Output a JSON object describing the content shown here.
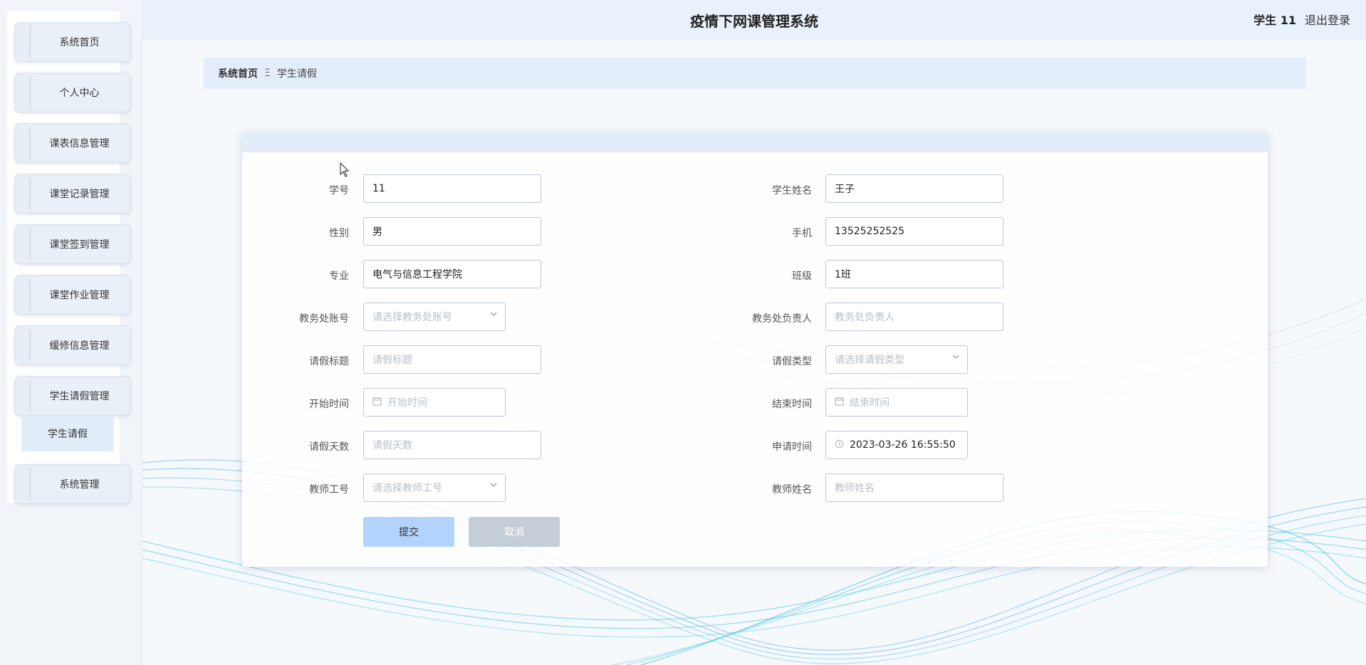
{
  "header": {
    "title": "疫情下网课管理系统",
    "user": "学生 11",
    "logout": "退出登录"
  },
  "sidebar": {
    "items": [
      {
        "label": "系统首页"
      },
      {
        "label": "个人中心"
      },
      {
        "label": "课表信息管理"
      },
      {
        "label": "课堂记录管理"
      },
      {
        "label": "课堂签到管理"
      },
      {
        "label": "课堂作业管理"
      },
      {
        "label": "缓修信息管理"
      },
      {
        "label": "学生请假管理"
      },
      {
        "label": "系统管理"
      }
    ],
    "submenu": {
      "label": "学生请假"
    }
  },
  "breadcrumb": {
    "home": "系统首页",
    "separator": "Ξ",
    "current": "学生请假"
  },
  "form": {
    "student_no": {
      "label": "学号",
      "value": "11"
    },
    "student_name": {
      "label": "学生姓名",
      "value": "王子"
    },
    "gender": {
      "label": "性别",
      "value": "男"
    },
    "phone": {
      "label": "手机",
      "value": "13525252525"
    },
    "major": {
      "label": "专业",
      "value": "电气与信息工程学院"
    },
    "class": {
      "label": "班级",
      "value": "1班"
    },
    "office_account": {
      "label": "教务处账号",
      "placeholder": "请选择教务处账号"
    },
    "office_manager": {
      "label": "教务处负责人",
      "placeholder": "教务处负责人"
    },
    "leave_title": {
      "label": "请假标题",
      "placeholder": "请假标题"
    },
    "leave_type": {
      "label": "请假类型",
      "placeholder": "请选择请假类型"
    },
    "start_time": {
      "label": "开始时间",
      "placeholder": "开始时间"
    },
    "end_time": {
      "label": "结束时间",
      "placeholder": "结束时间"
    },
    "leave_days": {
      "label": "请假天数",
      "placeholder": "请假天数"
    },
    "apply_time": {
      "label": "申请时间",
      "value": "2023-03-26 16:55:50"
    },
    "teacher_id": {
      "label": "教师工号",
      "placeholder": "请选择教师工号"
    },
    "teacher_name": {
      "label": "教师姓名",
      "placeholder": "教师姓名"
    },
    "submit": "提交",
    "cancel": "取消"
  },
  "icons": {
    "calendar": "calendar-icon",
    "clock": "clock-icon",
    "chevron": "chevron-down-icon",
    "cursor": "mouse-cursor-icon"
  },
  "colors": {
    "primary_button": "#b2d3fb",
    "cancel_button": "#c5cdd6",
    "header_bg": "#e9f1fb",
    "wave": "#3fb6e6"
  }
}
